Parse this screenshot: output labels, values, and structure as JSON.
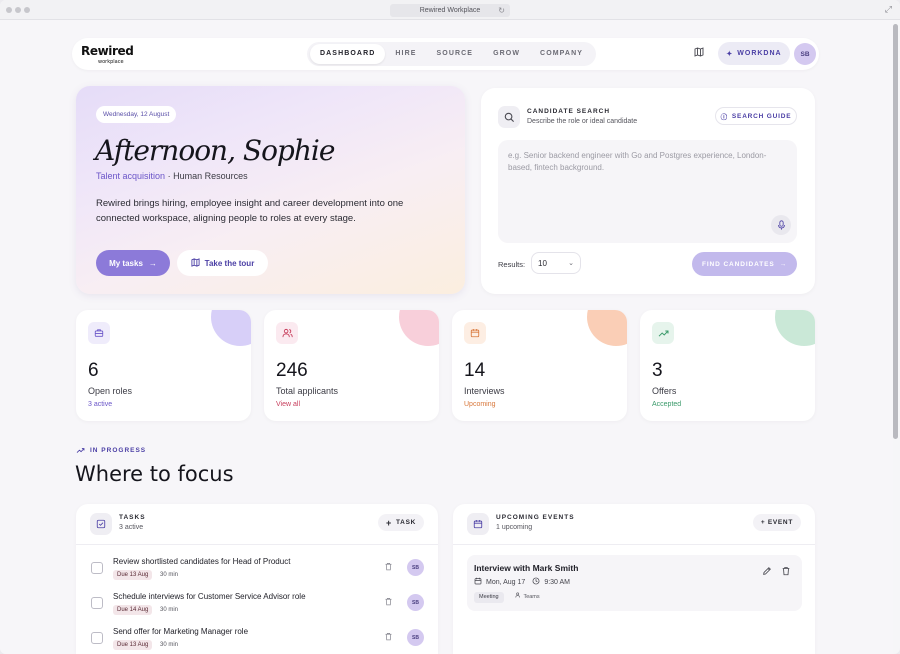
{
  "browser": {
    "title": "Rewired Workplace"
  },
  "brand": {
    "name": "Rewired",
    "tagline": "workplace"
  },
  "nav": {
    "tabs": [
      "DASHBOARD",
      "HIRE",
      "SOURCE",
      "GROW",
      "COMPANY"
    ],
    "active_tab": "DASHBOARD",
    "workdna_label": "WORKDNA",
    "avatar_initials": "SB"
  },
  "hero": {
    "date": "Wednesday, 12 August",
    "greeting": "Afternoon, Sophie",
    "role_highlight": "Talent acquisition",
    "role_separator": "·",
    "role_department": "Human Resources",
    "description": "Rewired brings hiring, employee insight and career development into one connected workspace, aligning people to roles at every stage.",
    "primary_button": "My tasks",
    "tour_button": "Take the tour"
  },
  "candidate_search": {
    "title": "CANDIDATE SEARCH",
    "subtitle": "Describe the role or ideal candidate",
    "guide_label": "SEARCH GUIDE",
    "placeholder": "e.g. Senior backend engineer with Go and Postgres experience, London-based, fintech background.",
    "results_label": "Results:",
    "results_value": "10",
    "find_button": "FIND CANDIDATES"
  },
  "stats": [
    {
      "value": "6",
      "label": "Open roles",
      "sub": "3 active",
      "icon": "briefcase-icon",
      "color": "#6a55c8"
    },
    {
      "value": "246",
      "label": "Total applicants",
      "sub": "View all",
      "icon": "users-icon",
      "color": "#c8405e"
    },
    {
      "value": "14",
      "label": "Interviews",
      "sub": "Upcoming",
      "icon": "calendar-icon",
      "color": "#d8773a"
    },
    {
      "value": "3",
      "label": "Offers",
      "sub": "Accepted",
      "icon": "trending-up-icon",
      "color": "#3a9a6a"
    }
  ],
  "section": {
    "eyebrow": "IN PROGRESS",
    "title": "Where to focus"
  },
  "tasks_panel": {
    "title": "TASKS",
    "subtitle": "3 active",
    "add_label": "TASK",
    "items": [
      {
        "text": "Review shortlisted candidates for Head of Product",
        "due": "Due 13 Aug",
        "duration": "30 min",
        "assignee": "SB"
      },
      {
        "text": "Schedule interviews for Customer Service Advisor role",
        "due": "Due 14 Aug",
        "duration": "30 min",
        "assignee": "SB"
      },
      {
        "text": "Send offer for Marketing Manager role",
        "due": "Due 13 Aug",
        "duration": "30 min",
        "assignee": "SB"
      }
    ]
  },
  "events_panel": {
    "title": "UPCOMING EVENTS",
    "subtitle": "1 upcoming",
    "add_label": "+ EVENT",
    "event": {
      "title": "Interview with Mark Smith",
      "date": "Mon, Aug 17",
      "time": "9:30 AM",
      "tag": "Meeting",
      "platform": "Teams"
    }
  }
}
